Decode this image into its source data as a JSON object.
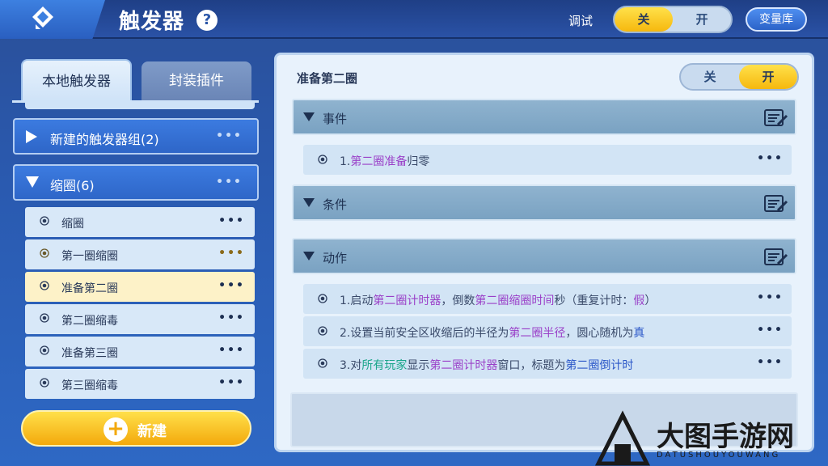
{
  "header": {
    "title": "触发器",
    "help_glyph": "?",
    "debug_label": "调试",
    "debug_toggle": {
      "off_label": "关",
      "on_label": "开",
      "state": "off"
    },
    "variable_library_button": "变量库"
  },
  "sidebar": {
    "tabs": [
      {
        "label": "本地触发器",
        "active": true
      },
      {
        "label": "封装插件",
        "active": false
      }
    ],
    "groups": [
      {
        "label": "新建的触发器组(2)",
        "expanded": false
      },
      {
        "label": "缩圈(6)",
        "expanded": true
      }
    ],
    "items": [
      {
        "label": "缩圈",
        "selected": false
      },
      {
        "label": "第一圈缩圈",
        "selected": false
      },
      {
        "label": "准备第二圈",
        "selected": true
      },
      {
        "label": "第二圈缩毒",
        "selected": false
      },
      {
        "label": "准备第三圈",
        "selected": false
      },
      {
        "label": "第三圈缩毒",
        "selected": false
      }
    ],
    "more_glyph": "•••",
    "new_button": {
      "label": "新建",
      "icon": "plus-icon"
    }
  },
  "detail": {
    "title": "准备第二圈",
    "enable_toggle": {
      "off_label": "关",
      "on_label": "开",
      "state": "on"
    },
    "sections": [
      {
        "label": "事件"
      },
      {
        "label": "条件"
      },
      {
        "label": "动作"
      }
    ],
    "event_entries": [
      {
        "parts": [
          "1.",
          "第二圈准备",
          "归零"
        ]
      }
    ],
    "action_entries": [
      {
        "parts": [
          "1.启动",
          "第二圈计时器",
          "，倒数",
          "第二圈缩圈时间",
          "秒（重复计时：",
          "假",
          "）"
        ]
      },
      {
        "parts": [
          "2.设置当前安全区收缩后的半径为",
          "第二圈半径",
          "，圆心随机为",
          "真"
        ]
      },
      {
        "parts": [
          "3.对",
          "所有玩家",
          "显示",
          "第二圈计时器",
          "窗口，标题为",
          "第二圈倒计时"
        ]
      }
    ]
  },
  "watermark": {
    "text": "大图手游网",
    "subtext": "DATUSHOUYOUWANG"
  },
  "colors": {
    "accent_yellow": "#f6b80e",
    "primary_blue": "#2e66c8",
    "highlight_purple": "#9a3fc8",
    "highlight_green": "#1aa58a",
    "highlight_blue": "#2a56c8"
  }
}
